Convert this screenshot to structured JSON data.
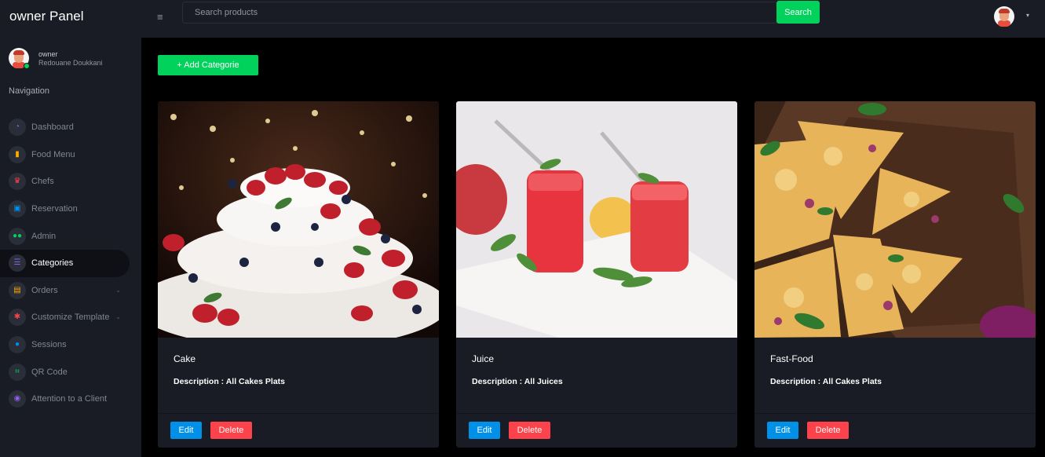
{
  "app": {
    "title": "owner Panel"
  },
  "profile": {
    "role": "owner",
    "name": "Redouane Doukkani"
  },
  "nav": {
    "title": "Navigation",
    "items": [
      {
        "label": "Dashboard",
        "icon": "speedometer-icon",
        "color": "#8f5fe8"
      },
      {
        "label": "Food Menu",
        "icon": "thumbs-up-icon",
        "color": "#ffab00"
      },
      {
        "label": "Chefs",
        "icon": "chef-icon",
        "color": "#fc424a"
      },
      {
        "label": "Reservation",
        "icon": "calendar-icon",
        "color": "#0090e7"
      },
      {
        "label": "Admin",
        "icon": "users-icon",
        "color": "#00d25b"
      },
      {
        "label": "Categories",
        "icon": "list-icon",
        "color": "#8f5fe8"
      },
      {
        "label": "Orders",
        "icon": "document-icon",
        "color": "#ffab00"
      },
      {
        "label": "Customize Template",
        "icon": "gear-icon",
        "color": "#fc424a"
      },
      {
        "label": "Sessions",
        "icon": "globe-icon",
        "color": "#0090e7"
      },
      {
        "label": "QR Code",
        "icon": "qr-code-icon",
        "color": "#00d25b"
      },
      {
        "label": "Attention to a Client",
        "icon": "eye-icon",
        "color": "#8f5fe8"
      }
    ]
  },
  "search": {
    "placeholder": "Search products",
    "button": "Search"
  },
  "main": {
    "add_button": "+ Add Categorie"
  },
  "categories": [
    {
      "name": "Cake",
      "description": "Description : All Cakes Plats",
      "edit": "Edit",
      "delete": "Delete"
    },
    {
      "name": "Juice",
      "description": "Description : All Juices",
      "edit": "Edit",
      "delete": "Delete"
    },
    {
      "name": "Fast-Food",
      "description": "Description : All Cakes Plats",
      "edit": "Edit",
      "delete": "Delete"
    }
  ],
  "colors": {
    "sidebar": "#191c24",
    "success": "#00d25b",
    "primary": "#0090e7",
    "danger": "#fc424a"
  }
}
